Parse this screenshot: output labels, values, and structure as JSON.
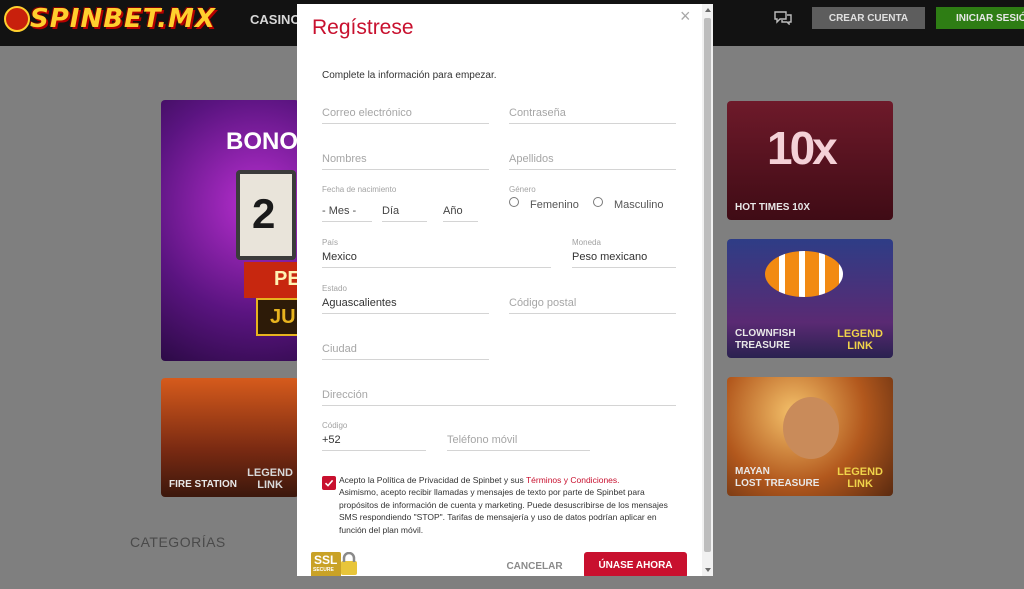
{
  "site": {
    "logo_text": "SPINBET.MX",
    "nav_casino": "CASINO",
    "create_account": "CREAR CUENTA",
    "login": "INICIAR SESIÓN",
    "categories": "CATEGORÍAS"
  },
  "banner": {
    "title": "BONO D",
    "reel_number": "2",
    "line1": "PE",
    "line2": "JU"
  },
  "games": [
    {
      "name": "FIRE STATION",
      "badge": "LEGEND\nLINK"
    },
    {
      "name": "HOT TIMES 10X",
      "badge": ""
    },
    {
      "name": "CLOWNFISH\nTREASURE",
      "badge": "LEGEND\nLINK"
    },
    {
      "name": "MAYAN\nLOST TREASURE",
      "badge": "LEGEND\nLINK"
    }
  ],
  "hot_times_art": "10x",
  "modal": {
    "title": "Regístrese",
    "close": "×",
    "intro": "Complete la información para empezar.",
    "email_placeholder": "Correo electrónico",
    "password_placeholder": "Contraseña",
    "first_name_placeholder": "Nombres",
    "last_name_placeholder": "Apellidos",
    "birth_label": "Fecha de nacimiento",
    "birth_month": "- Mes -",
    "birth_day": "Día",
    "birth_year": "Año",
    "gender_label": "Género",
    "gender_female": "Femenino",
    "gender_male": "Masculino",
    "country_label": "País",
    "country_value": "Mexico",
    "currency_label": "Moneda",
    "currency_value": "Peso mexicano",
    "state_label": "Estado",
    "state_value": "Aguascalientes",
    "postal_placeholder": "Código postal",
    "city_placeholder": "Ciudad",
    "address_placeholder": "Dirección",
    "code_label": "Código",
    "code_value": "+52",
    "phone_placeholder": "Teléfono móvil",
    "terms_prefix": "Acepto la Política de Privacidad de Spinbet y sus ",
    "terms_link": "Términos y Condiciones.",
    "terms_rest": "Asimismo, acepto recibir llamadas y mensajes de texto por parte de Spinbet para propósitos de información de cuenta y marketing. Puede desuscribirse de los mensajes SMS respondiendo \"STOP\". Tarifas de mensajería y uso de datos podrían aplicar en función del plan móvil.",
    "terms_checked": true,
    "ssl_text": "SSL",
    "ssl_sub": "SECURE",
    "cancel": "CANCELAR",
    "submit": "ÚNASE AHORA"
  },
  "colors": {
    "accent": "#c8102e",
    "login_green": "#2e7d14",
    "topbar": "#121212"
  }
}
